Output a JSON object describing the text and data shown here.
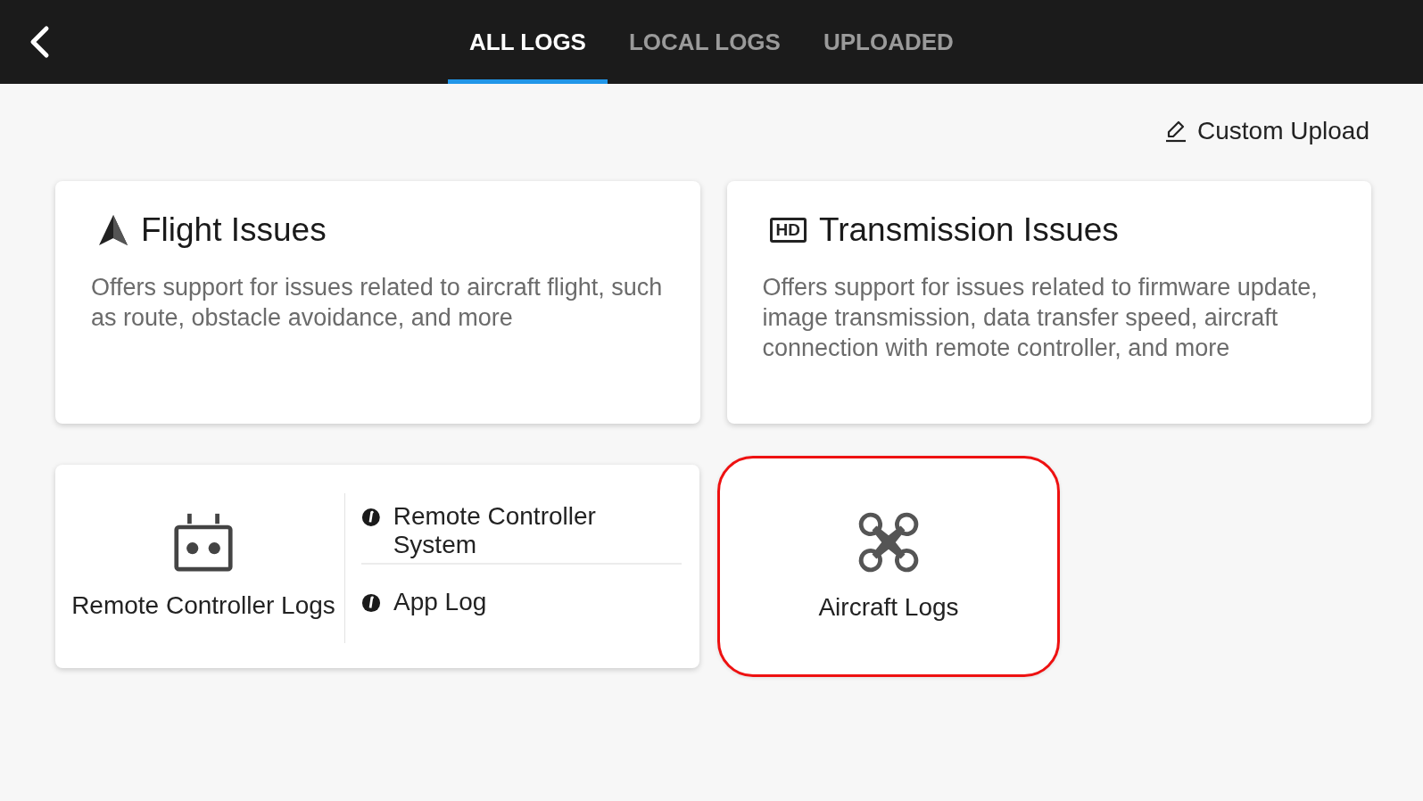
{
  "header": {
    "tabs": [
      {
        "label": "ALL LOGS",
        "selected": true
      },
      {
        "label": "LOCAL LOGS",
        "selected": false
      },
      {
        "label": "UPLOADED",
        "selected": false
      }
    ]
  },
  "custom_upload": {
    "label": "Custom Upload"
  },
  "issue_cards": [
    {
      "kind": "flight",
      "title": "Flight Issues",
      "description": "Offers support for issues related to aircraft flight, such as route, obstacle avoidance, and more"
    },
    {
      "kind": "transmission",
      "badge": "HD",
      "title": "Transmission Issues",
      "description": "Offers support for issues related to firmware update, image transmission, data transfer speed, aircraft connection with remote controller, and more"
    }
  ],
  "remote_controller_card": {
    "title": "Remote Controller Logs",
    "items": [
      {
        "label": "Remote Controller System"
      },
      {
        "label": "App Log"
      }
    ]
  },
  "aircraft_card": {
    "title": "Aircraft Logs",
    "highlighted": true
  }
}
